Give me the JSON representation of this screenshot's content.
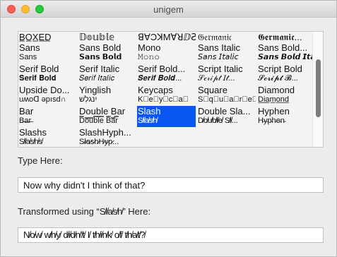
{
  "window": {
    "title": "unigem"
  },
  "styles": [
    {
      "name": "B̲O̲X̲E̲D̲",
      "sample": "·̣̣̣·̣̣ ̣̣̣̣"
    },
    {
      "name": "Sans",
      "sample": "Sans"
    },
    {
      "name": "Serif Bold",
      "sample": "𝐒𝐞𝐫𝐢𝐟 𝐁𝐨𝐥𝐝"
    },
    {
      "name": "Upside Do...",
      "sample": "uʍoᗡ ǝpısd∩"
    },
    {
      "name": "Bar",
      "sample": "B̶a̶r̶"
    },
    {
      "name": "Slashs",
      "sample": "S̸l̸a̸s̸h̸s̸"
    },
    {
      "name": "𝔻𝕠𝕦𝕓𝕝𝕖",
      "sample": ""
    },
    {
      "name": "Sans Bold",
      "sample": "𝗦𝗮𝗻𝘀 𝗕𝗼𝗹𝗱"
    },
    {
      "name": "Serif Italic",
      "sample": "𝑆𝑒𝑟𝑖𝑓 𝐼𝑡𝑎𝑙𝑖𝑐"
    },
    {
      "name": "Yinglish",
      "sample": "יִנגלִשׁ"
    },
    {
      "name": "Double Bar",
      "sample": "D̿o̿u̿b̿l̿e̿ B̿a̿r̿"
    },
    {
      "name": "SlashHyph...",
      "sample": "S̷l̷a̷s̷h̷H̷y̷p̷..."
    },
    {
      "name": "ꓭ∀ƆꓘMⱯꓤⅅꙄ",
      "sample": ""
    },
    {
      "name": "Mono",
      "sample": "𝙼𝚘𝚗𝚘"
    },
    {
      "name": "Serif Bold...",
      "sample": "𝑺𝒆𝒓𝒊𝒇 𝑩𝒐𝒍𝒅..."
    },
    {
      "name": "Keycaps",
      "sample": "K⃣e⃣y⃣c⃣a⃣"
    },
    {
      "name": "Slash",
      "sample": "S̸l̸a̸s̸h̸"
    },
    {
      "name": "",
      "sample": ""
    },
    {
      "name": "𝔊𝔢𝔯𝔪𝔞𝔫𝔦𝔠",
      "sample": ""
    },
    {
      "name": "Sans Italic",
      "sample": "𝘚𝘢𝘯𝘴 𝘐𝘵𝘢𝘭𝘪𝘤"
    },
    {
      "name": "Script Italic",
      "sample": "𝒮𝒸𝓇𝒾𝓅𝓉 𝐼𝓉..."
    },
    {
      "name": "Square",
      "sample": "S⃞q⃞u⃞a⃞r⃞e⃞"
    },
    {
      "name": "Double Sla...",
      "sample": "D̸̸o̸̸u̸̸b̸̸l̸̸e̸̸ S̸̸l̸̸..."
    },
    {
      "name": "",
      "sample": ""
    },
    {
      "name": "𝕲𝖊𝖗𝖒𝖆𝖓𝖎𝖈...",
      "sample": ""
    },
    {
      "name": "Sans Bold...",
      "sample": "𝙎𝙖𝙣𝙨 𝘽𝙤𝙡𝙙 𝙄𝙩𝙖𝙡𝙞𝙘"
    },
    {
      "name": "Script Bold",
      "sample": "𝓢𝓬𝓻𝓲𝓹𝓽 𝓑..."
    },
    {
      "name": "Diamond",
      "sample": "D̲i̲a̲m̲o̲n̲d̲"
    },
    {
      "name": "Hyphen",
      "sample": "H̵y̵p̵h̵e̵n̵"
    },
    {
      "name": "",
      "sample": ""
    }
  ],
  "type_label": "Type Here:",
  "input_value": "Now why didn't I think of that?",
  "transformed_label": "Transformed using “S̸l̸a̸s̸h̸” Here:",
  "output_value": "N̸o̸w̸ w̸h̸y̸ d̸i̸d̸n̸'̸t̸ I̸ t̸h̸i̸n̸k̸ o̸f̸ t̸h̸a̸t̸?̸"
}
